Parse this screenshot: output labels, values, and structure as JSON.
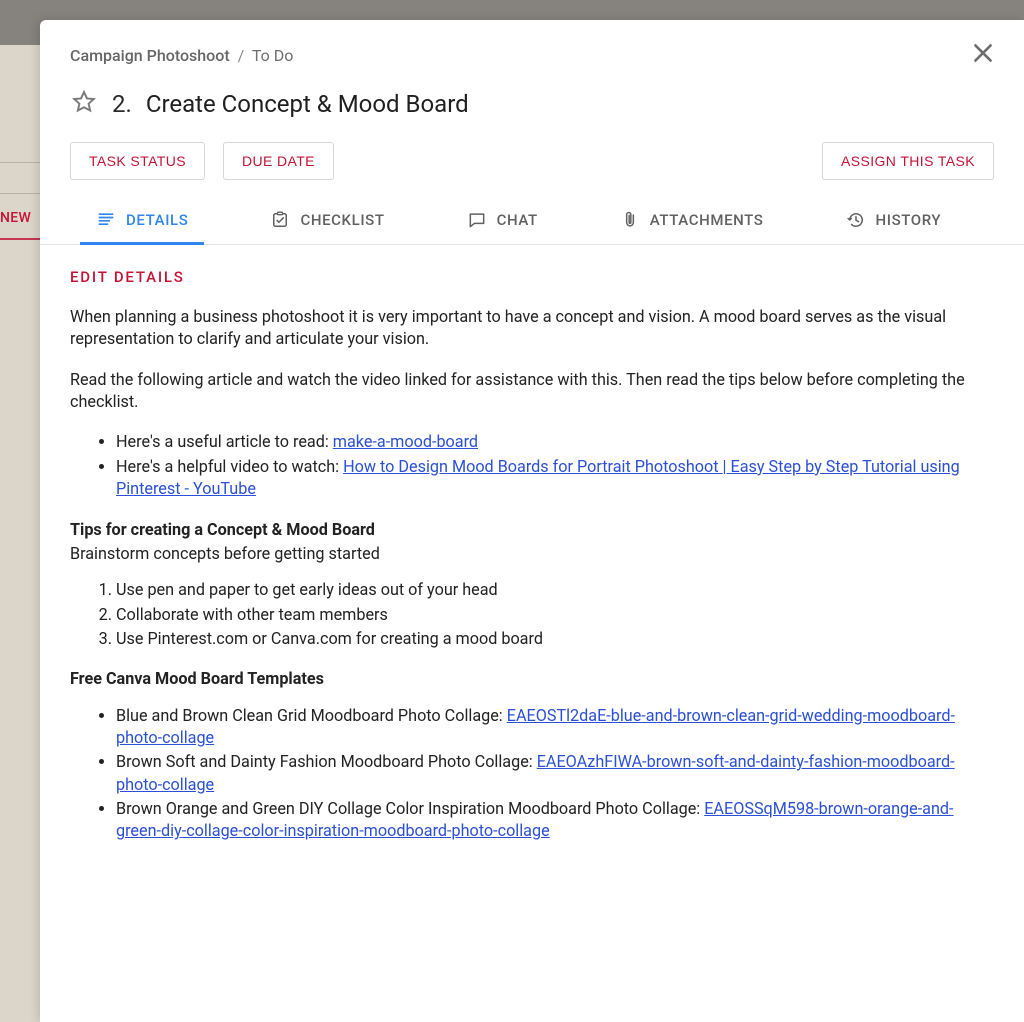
{
  "background": {
    "new_label": "NEW"
  },
  "breadcrumb": {
    "parent": "Campaign Photoshoot",
    "separator": "/",
    "current": "To Do"
  },
  "task": {
    "number": "2.",
    "title": "Create Concept & Mood Board"
  },
  "actions": {
    "task_status": "TASK STATUS",
    "due_date": "DUE DATE",
    "assign": "ASSIGN THIS TASK"
  },
  "tabs": {
    "details": "DETAILS",
    "checklist": "CHECKLIST",
    "chat": "CHAT",
    "attachments": "ATTACHMENTS",
    "history": "HISTORY"
  },
  "edit_details_label": "EDIT DETAILS",
  "details": {
    "p1": "When planning a business photoshoot it is very important to have a concept and vision. A mood board serves as the visual representation to clarify and articulate your vision.",
    "p2": "Read the following article and watch the video linked for assistance with this. Then read the tips below before completing the checklist.",
    "resources": [
      {
        "lead": "Here's a useful article to read: ",
        "link": "make-a-mood-board"
      },
      {
        "lead": "Here's a helpful video to watch: ",
        "link": "How to Design Mood Boards for Portrait Photoshoot | Easy Step by Step Tutorial using Pinterest - YouTube"
      }
    ],
    "tips_heading": "Tips for creating a Concept & Mood Board",
    "tips_sub": "Brainstorm concepts before getting started",
    "tips": [
      "Use pen and paper to get early ideas out of your head",
      "Collaborate with other team members",
      "Use Pinterest.com or Canva.com for creating a mood board"
    ],
    "templates_heading": "Free Canva Mood Board Templates",
    "templates": [
      {
        "lead": "Blue and Brown Clean Grid Moodboard Photo Collage: ",
        "link": "EAEOSTl2daE-blue-and-brown-clean-grid-wedding-moodboard-photo-collage"
      },
      {
        "lead": "Brown Soft and Dainty Fashion Moodboard Photo Collage: ",
        "link": "EAEOAzhFIWA-brown-soft-and-dainty-fashion-moodboard-photo-collage"
      },
      {
        "lead": "Brown Orange and Green DIY Collage Color Inspiration Moodboard Photo Collage: ",
        "link": "EAEOSSqM598-brown-orange-and-green-diy-collage-color-inspiration-moodboard-photo-collage"
      }
    ]
  }
}
